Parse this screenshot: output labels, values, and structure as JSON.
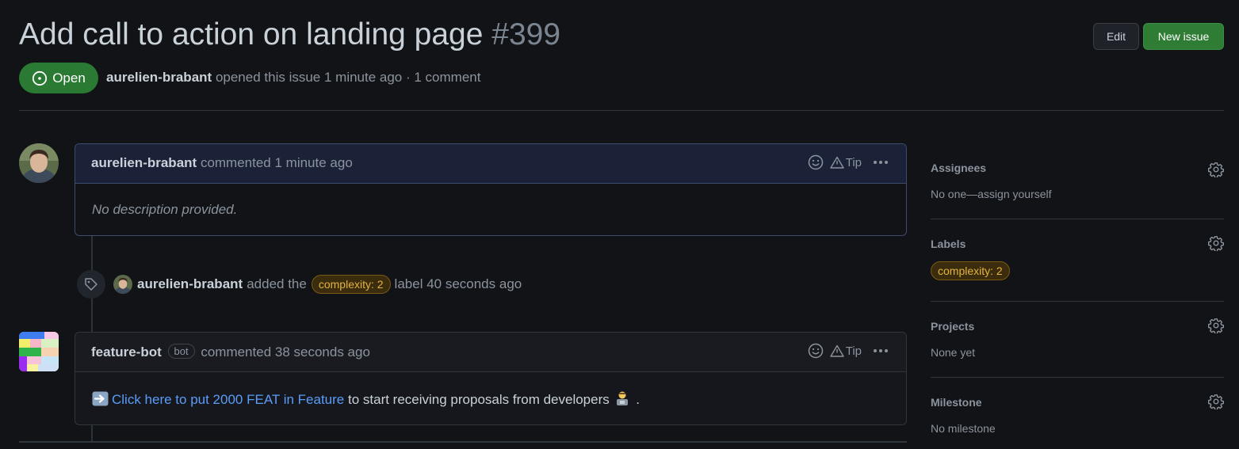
{
  "issue": {
    "title": "Add call to action on landing page",
    "number": "#399",
    "state": "Open",
    "author": "aurelien-brabant",
    "meta_text": "opened this issue 1 minute ago · 1 comment"
  },
  "header_buttons": {
    "edit": "Edit",
    "new_issue": "New issue"
  },
  "comments": [
    {
      "author": "aurelien-brabant",
      "action": "commented 1 minute ago",
      "tip": "Tip",
      "body": "No description provided."
    },
    {
      "author": "feature-bot",
      "badge": "bot",
      "action": "commented 38 seconds ago",
      "tip": "Tip",
      "body_link": "Click here to put 2000 FEAT in Feature",
      "body_rest": "to start receiving proposals from developers",
      "body_end": "."
    }
  ],
  "event": {
    "actor": "aurelien-brabant",
    "text_before": "added the",
    "label": "complexity: 2",
    "text_after": "label 40 seconds ago"
  },
  "sidebar": {
    "assignees": {
      "title": "Assignees",
      "value": "No one—assign yourself"
    },
    "labels": {
      "title": "Labels",
      "label": "complexity: 2"
    },
    "projects": {
      "title": "Projects",
      "value": "None yet"
    },
    "milestone": {
      "title": "Milestone",
      "value": "No milestone"
    }
  },
  "colors": {
    "background": "#121317",
    "open_green": "#2b7a33",
    "link_blue": "#5a9cf8",
    "label_yellow": "#e3b341"
  }
}
